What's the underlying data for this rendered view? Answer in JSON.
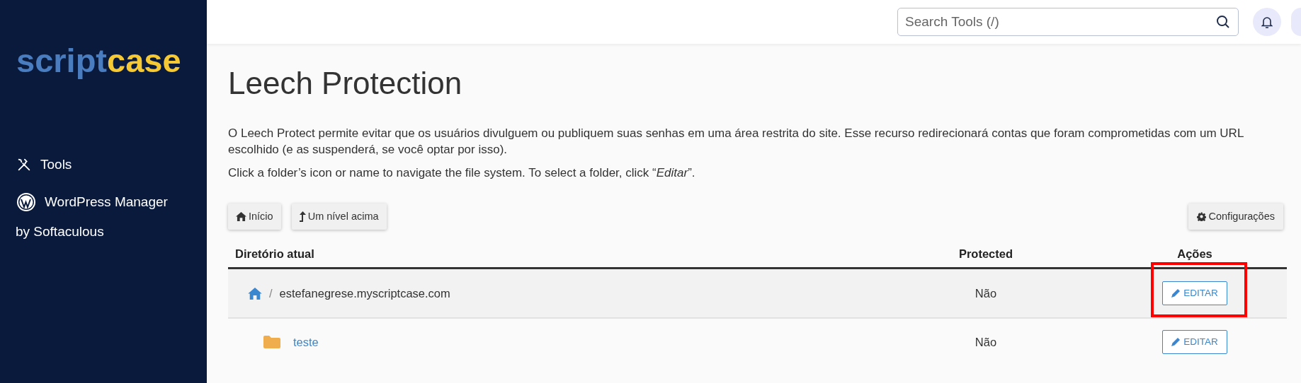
{
  "sidebar": {
    "logo": {
      "part_1": "script",
      "part_2": "case"
    },
    "items": [
      {
        "kind": "tools",
        "label": "Tools"
      },
      {
        "kind": "wordpress",
        "label": "WordPress Manager",
        "sublabel": "by Softaculous"
      }
    ]
  },
  "header": {
    "search": {
      "placeholder": "Search Tools (/)"
    }
  },
  "page": {
    "title": "Leech Protection",
    "description": "O Leech Protect permite evitar que os usuários divulguem ou publiquem suas senhas em uma área restrita do site. Esse recurso redirecionará contas que foram comprometidas com um URL escolhido (e as suspenderá, se você optar por isso).",
    "hint": "Click a folder’s icon or name to navigate the file system. To select a folder, click “*Editar*”.",
    "toolbar": [
      {
        "kind": "home",
        "label": "Início"
      },
      {
        "kind": "up",
        "label": "Um nível acima"
      }
    ],
    "settings_button": "Configurações",
    "table": {
      "columns": [
        "Diretório atual",
        "Protected",
        "Ações"
      ],
      "rows": [
        {
          "kind": "root",
          "separator": "/",
          "name": "estefanegrese.myscriptcase.com",
          "protected": "Não",
          "action": "EDITAR",
          "highlighted": true
        },
        {
          "kind": "folder",
          "name": "teste",
          "protected": "Não",
          "action": "EDITAR",
          "highlighted": false
        }
      ]
    }
  }
}
